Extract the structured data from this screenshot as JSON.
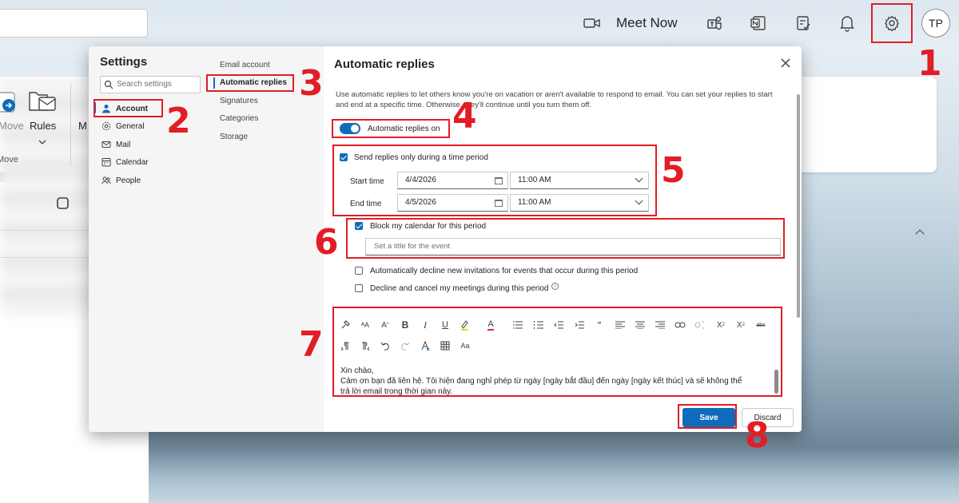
{
  "topbar": {
    "meet_now_label": "Meet Now",
    "avatar_initials": "TP"
  },
  "ribbon": {
    "move_label": "Move",
    "move_group_label": "Move",
    "rules_label": "Rules",
    "m_label": "M"
  },
  "dialog": {
    "settings_title": "Settings",
    "search_placeholder": "Search settings",
    "nav": [
      {
        "label": "Account",
        "icon": "person-icon"
      },
      {
        "label": "General",
        "icon": "gear-icon"
      },
      {
        "label": "Mail",
        "icon": "mail-icon"
      },
      {
        "label": "Calendar",
        "icon": "calendar-icon"
      },
      {
        "label": "People",
        "icon": "people-icon"
      }
    ],
    "sub_nav": [
      "Email account",
      "Automatic replies",
      "Signatures",
      "Categories",
      "Storage"
    ],
    "content": {
      "title": "Automatic replies",
      "description": "Use automatic replies to let others know you're on vacation or aren't available to respond to email. You can set your replies to start and end at a specific time. Otherwise, they'll continue until you turn them off.",
      "toggle_label": "Automatic replies on",
      "toggle_on": true,
      "send_period_label": "Send replies only during a time period",
      "send_period_checked": true,
      "start_time_label": "Start time",
      "start_date": "4/4/2026",
      "start_time": "11:00 AM",
      "end_time_label": "End time",
      "end_date": "4/5/2026",
      "end_time": "11:00 AM",
      "block_calendar_label": "Block my calendar for this period",
      "block_calendar_checked": true,
      "event_title_placeholder": "Set a title for the event",
      "decline_invites_label": "Automatically decline new invitations for events that occur during this period",
      "decline_invites_checked": false,
      "cancel_meetings_label": "Decline and cancel my meetings during this period",
      "cancel_meetings_checked": false,
      "editor_lines": [
        "Xin chào,",
        "Cảm ơn bạn đã liên hệ. Tôi hiện đang nghỉ phép từ ngày [ngày bắt đầu] đến ngày [ngày kết thúc] và sẽ không thể",
        "trả lời email trong thời gian này."
      ],
      "save_label": "Save",
      "discard_label": "Discard"
    }
  },
  "annotations": [
    "1",
    "2",
    "3",
    "4",
    "5",
    "6",
    "7",
    "8"
  ],
  "colors": {
    "accent": "#0f6cbd",
    "annotation_red": "#e11d26"
  }
}
